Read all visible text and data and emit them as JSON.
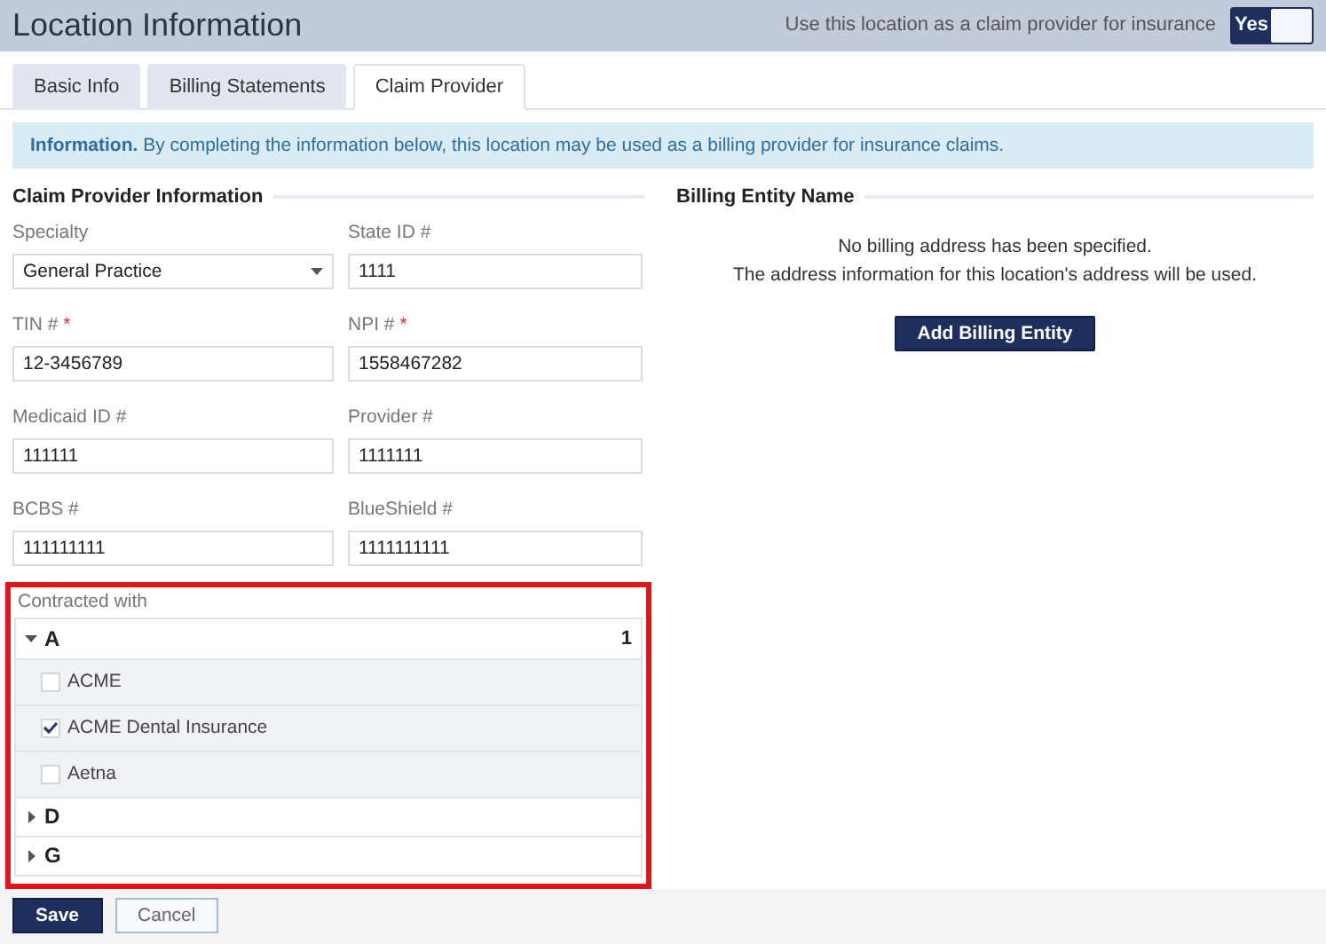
{
  "header": {
    "title": "Location Information",
    "toggle_label": "Use this location as a claim provider for insurance",
    "toggle": {
      "text": "Yes",
      "on": true
    }
  },
  "tabs": [
    {
      "label": "Basic Info",
      "selected": false
    },
    {
      "label": "Billing Statements",
      "selected": false
    },
    {
      "label": "Claim Provider",
      "selected": true
    }
  ],
  "info_banner": "**Information.** By completing the information below, this location may be used as a billing provider for insurance claims.",
  "claim_provider": {
    "title": "Claim Provider Information",
    "fields": [
      {
        "label": "Specialty",
        "value": "General Practice",
        "kind": "select"
      },
      {
        "label": "State ID #",
        "value": "1111",
        "kind": "text"
      },
      {
        "label": "TIN #",
        "required_mark": "*",
        "value": "12-3456789",
        "kind": "text"
      },
      {
        "label": "NPI #",
        "required_mark": "*",
        "value": "1558467282",
        "kind": "text"
      },
      {
        "label": "Medicaid ID #",
        "value": "111111",
        "kind": "text"
      },
      {
        "label": "Provider #",
        "value": "1111111",
        "kind": "text"
      },
      {
        "label": "BCBS #",
        "value": "111111111",
        "kind": "text"
      },
      {
        "label": "BlueShield #",
        "value": "1111111111",
        "kind": "text"
      }
    ]
  },
  "contracted": {
    "label": "Contracted with",
    "highlighted": true,
    "groups": [
      {
        "letter": "A",
        "count": "1",
        "expanded": true,
        "children": [
          {
            "label": "ACME",
            "checked": false
          },
          {
            "label": "ACME Dental Insurance",
            "checked": true
          },
          {
            "label": "Aetna",
            "checked": false
          }
        ]
      },
      {
        "letter": "D",
        "expanded": false
      },
      {
        "letter": "G",
        "expanded": false
      }
    ]
  },
  "billing_entity": {
    "title": "Billing Entity Name",
    "messages": [
      "No billing address has been specified.",
      "The address information for this location's address will be used."
    ],
    "button": "Add Billing Entity"
  },
  "footer": {
    "buttons": [
      {
        "label": "Save",
        "kind": "primary"
      },
      {
        "label": "Cancel",
        "kind": "secondary"
      }
    ]
  }
}
